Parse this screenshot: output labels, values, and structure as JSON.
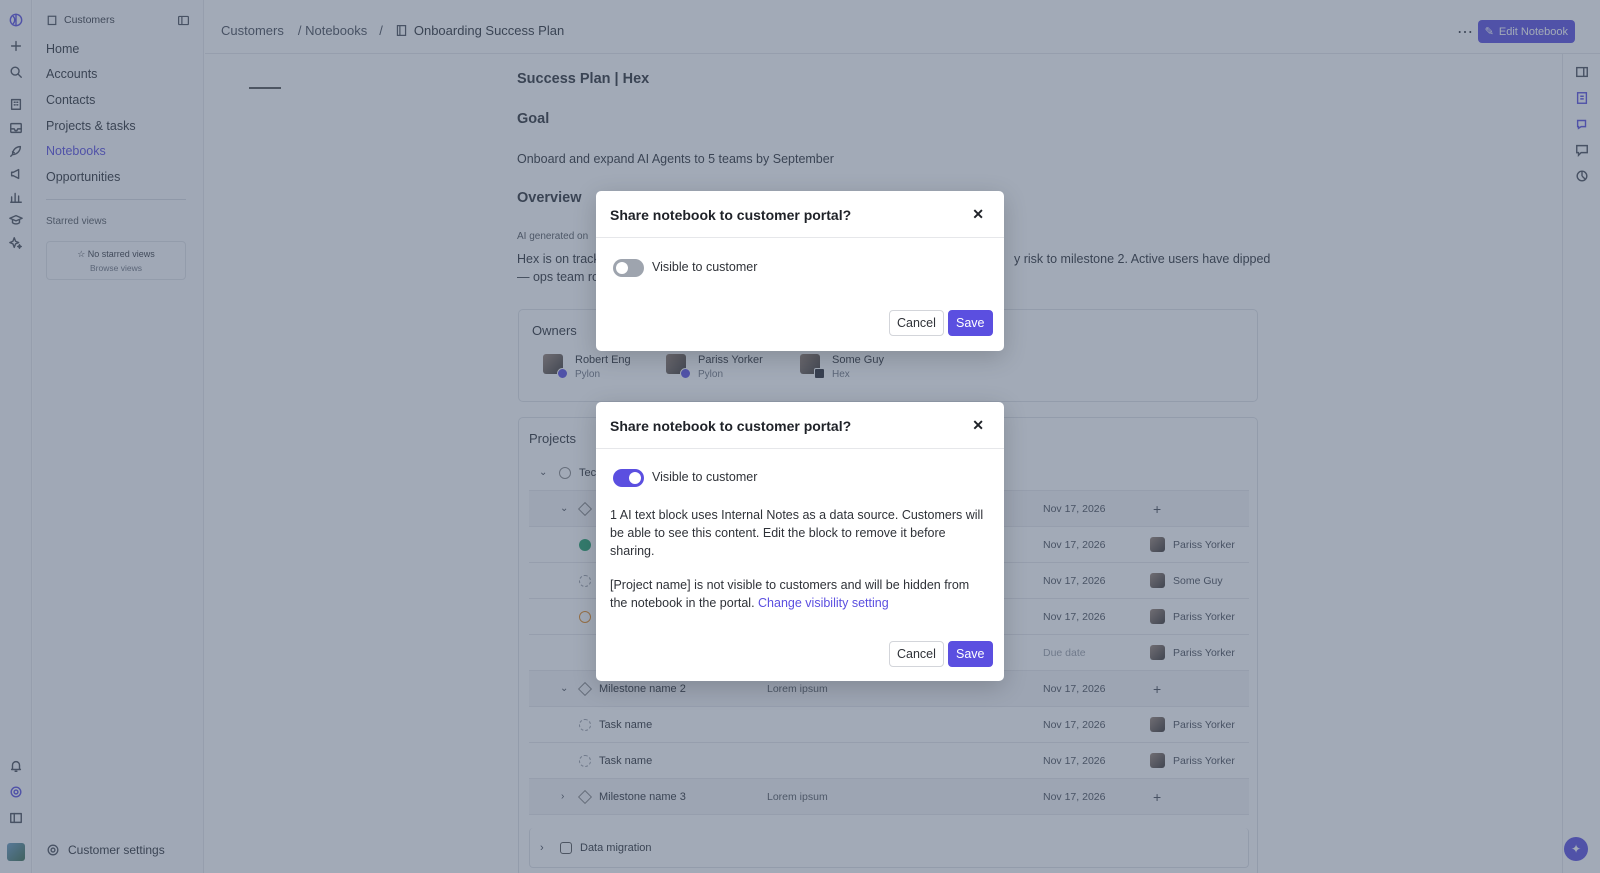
{
  "sidebar": {
    "workspace": "Customers",
    "nav": [
      "Home",
      "Accounts",
      "Contacts",
      "Projects & tasks",
      "Notebooks",
      "Opportunities"
    ],
    "active": "Notebooks",
    "starred_label": "Starred views",
    "starred_empty": "No starred views",
    "browse_views": "Browse views",
    "settings_label": "Customer settings"
  },
  "header": {
    "breadcrumb": [
      "Customers",
      "/ Notebooks",
      "/",
      "Onboarding Success Plan"
    ],
    "more": "⋯",
    "edit_label": "Edit Notebook"
  },
  "notebook": {
    "title": "Success Plan | Hex",
    "goal_heading": "Goal",
    "goal_text": "Onboard and expand AI Agents to 5 teams by September",
    "overview_heading": "Overview",
    "ai_generated": "AI generated on",
    "summary_a": "Hex is on track",
    "summary_b": "— ops team ro",
    "summary_c": "y risk to milestone 2.  Active users have dipped",
    "owners_label": "Owners",
    "owners": [
      {
        "name": "Robert Eng",
        "org": "Pylon"
      },
      {
        "name": "Pariss Yorker",
        "org": "Pylon"
      },
      {
        "name": "Some Guy",
        "org": "Hex"
      }
    ],
    "projects_label": "Projects",
    "project_1": "Tec",
    "rows": [
      {
        "date": "Nov 17, 2026"
      },
      {
        "date": "Nov 17, 2026",
        "assignee": "Pariss Yorker"
      },
      {
        "date": "Nov 17, 2026",
        "assignee": "Some Guy"
      },
      {
        "date": "Nov 17, 2026",
        "assignee": "Pariss Yorker"
      },
      {
        "date": "Due date",
        "assignee": "Pariss Yorker"
      },
      {
        "name": "Milestone name 2",
        "desc": "Lorem ipsum",
        "date": "Nov 17, 2026"
      },
      {
        "name": "Task name",
        "date": "Nov 17, 2026",
        "assignee": "Pariss Yorker"
      },
      {
        "name": "Task name",
        "date": "Nov 17, 2026",
        "assignee": "Pariss Yorker"
      },
      {
        "name": "Milestone name 3",
        "desc": "Lorem ipsum",
        "date": "Nov 17, 2026"
      }
    ],
    "project_2": "Data migration"
  },
  "modal_top": {
    "title": "Share notebook to customer portal?",
    "toggle_label": "Visible to customer",
    "toggle_on": false,
    "cancel": "Cancel",
    "save": "Save"
  },
  "modal_bottom": {
    "title": "Share notebook to customer portal?",
    "toggle_label": "Visible to customer",
    "toggle_on": true,
    "warning_1": "1 AI text block uses Internal Notes as a data source. Customers will be able to see this content. Edit the block to remove it before sharing.",
    "warning_2": "[Project name] is not visible to customers and will be hidden from the notebook in the portal. ",
    "link": "Change visibility setting",
    "cancel": "Cancel",
    "save": "Save"
  },
  "colors": {
    "accent": "#5b4fe0",
    "overlay": "#465670"
  }
}
